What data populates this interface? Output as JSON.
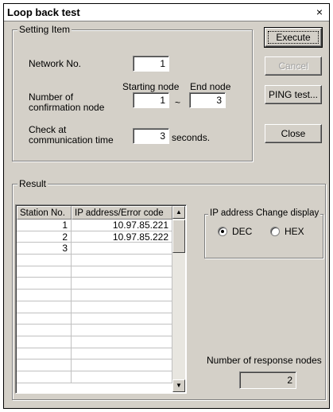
{
  "window": {
    "title": "Loop back test",
    "close_glyph": "×"
  },
  "setting": {
    "legend": "Setting Item",
    "network_no_label": "Network No.",
    "network_no_value": "1",
    "starting_node_label": "Starting node",
    "end_node_label": "End node",
    "confirmation_label_line1": "Number of",
    "confirmation_label_line2": "confirmation node",
    "starting_node_value": "1",
    "range_separator": "~",
    "end_node_value": "3",
    "check_label_line1": "Check at",
    "check_label_line2": "communication time",
    "check_time_value": "3",
    "seconds_label": "seconds."
  },
  "buttons": {
    "execute": "Execute",
    "cancel": "Cancel",
    "ping": "PING test...",
    "close": "Close"
  },
  "result": {
    "legend": "Result",
    "columns": [
      "Station No.",
      "IP address/Error code"
    ],
    "rows": [
      [
        "1",
        "10.97.85.221"
      ],
      [
        "2",
        "10.97.85.222"
      ],
      [
        "3",
        ""
      ],
      [
        "",
        ""
      ],
      [
        "",
        ""
      ],
      [
        "",
        ""
      ],
      [
        "",
        ""
      ],
      [
        "",
        ""
      ],
      [
        "",
        ""
      ],
      [
        "",
        ""
      ],
      [
        "",
        ""
      ],
      [
        "",
        ""
      ],
      [
        "",
        ""
      ],
      [
        "",
        ""
      ]
    ],
    "scroll_up_glyph": "▲",
    "scroll_down_glyph": "▼"
  },
  "ip_display": {
    "legend": "IP address Change display",
    "dec_label": "DEC",
    "hex_label": "HEX",
    "selected": "DEC"
  },
  "response": {
    "label": "Number of response nodes",
    "value": "2"
  }
}
